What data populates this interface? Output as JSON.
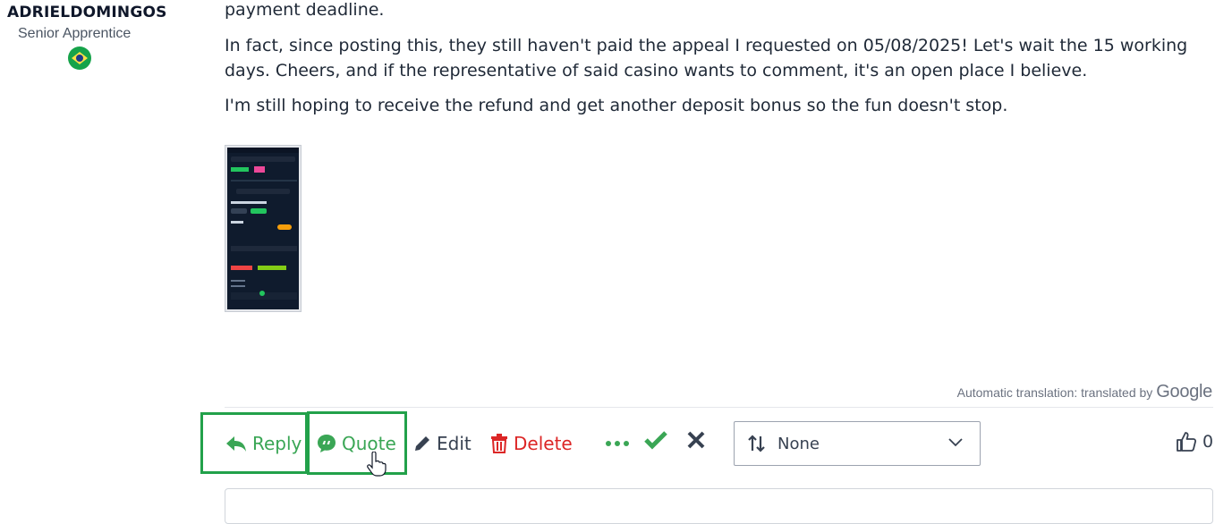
{
  "author": {
    "username": "ADRIELDOMINGOS",
    "rank": "Senior Apprentice"
  },
  "post": {
    "paragraph1": "payment deadline.",
    "paragraph2": "In fact, since posting this, they still haven't paid the appeal I requested on 05/08/2025! Let's wait the 15 working days. Cheers, and if the representative of said casino wants to comment, it's an open place I believe.",
    "paragraph3": "I'm still hoping to receive the refund and get another deposit bonus so the fun doesn't stop."
  },
  "translation": {
    "label": "Automatic translation: translated by",
    "provider": "Google"
  },
  "actions": {
    "reply": "Reply",
    "quote": "Quote",
    "edit": "Edit",
    "delete": "Delete"
  },
  "sort_select": {
    "value": "None"
  },
  "likes": {
    "count": "0"
  },
  "colors": {
    "green": "#3aa655",
    "red": "#dc2626",
    "highlight": "#22a14a",
    "dark": "#374151"
  }
}
